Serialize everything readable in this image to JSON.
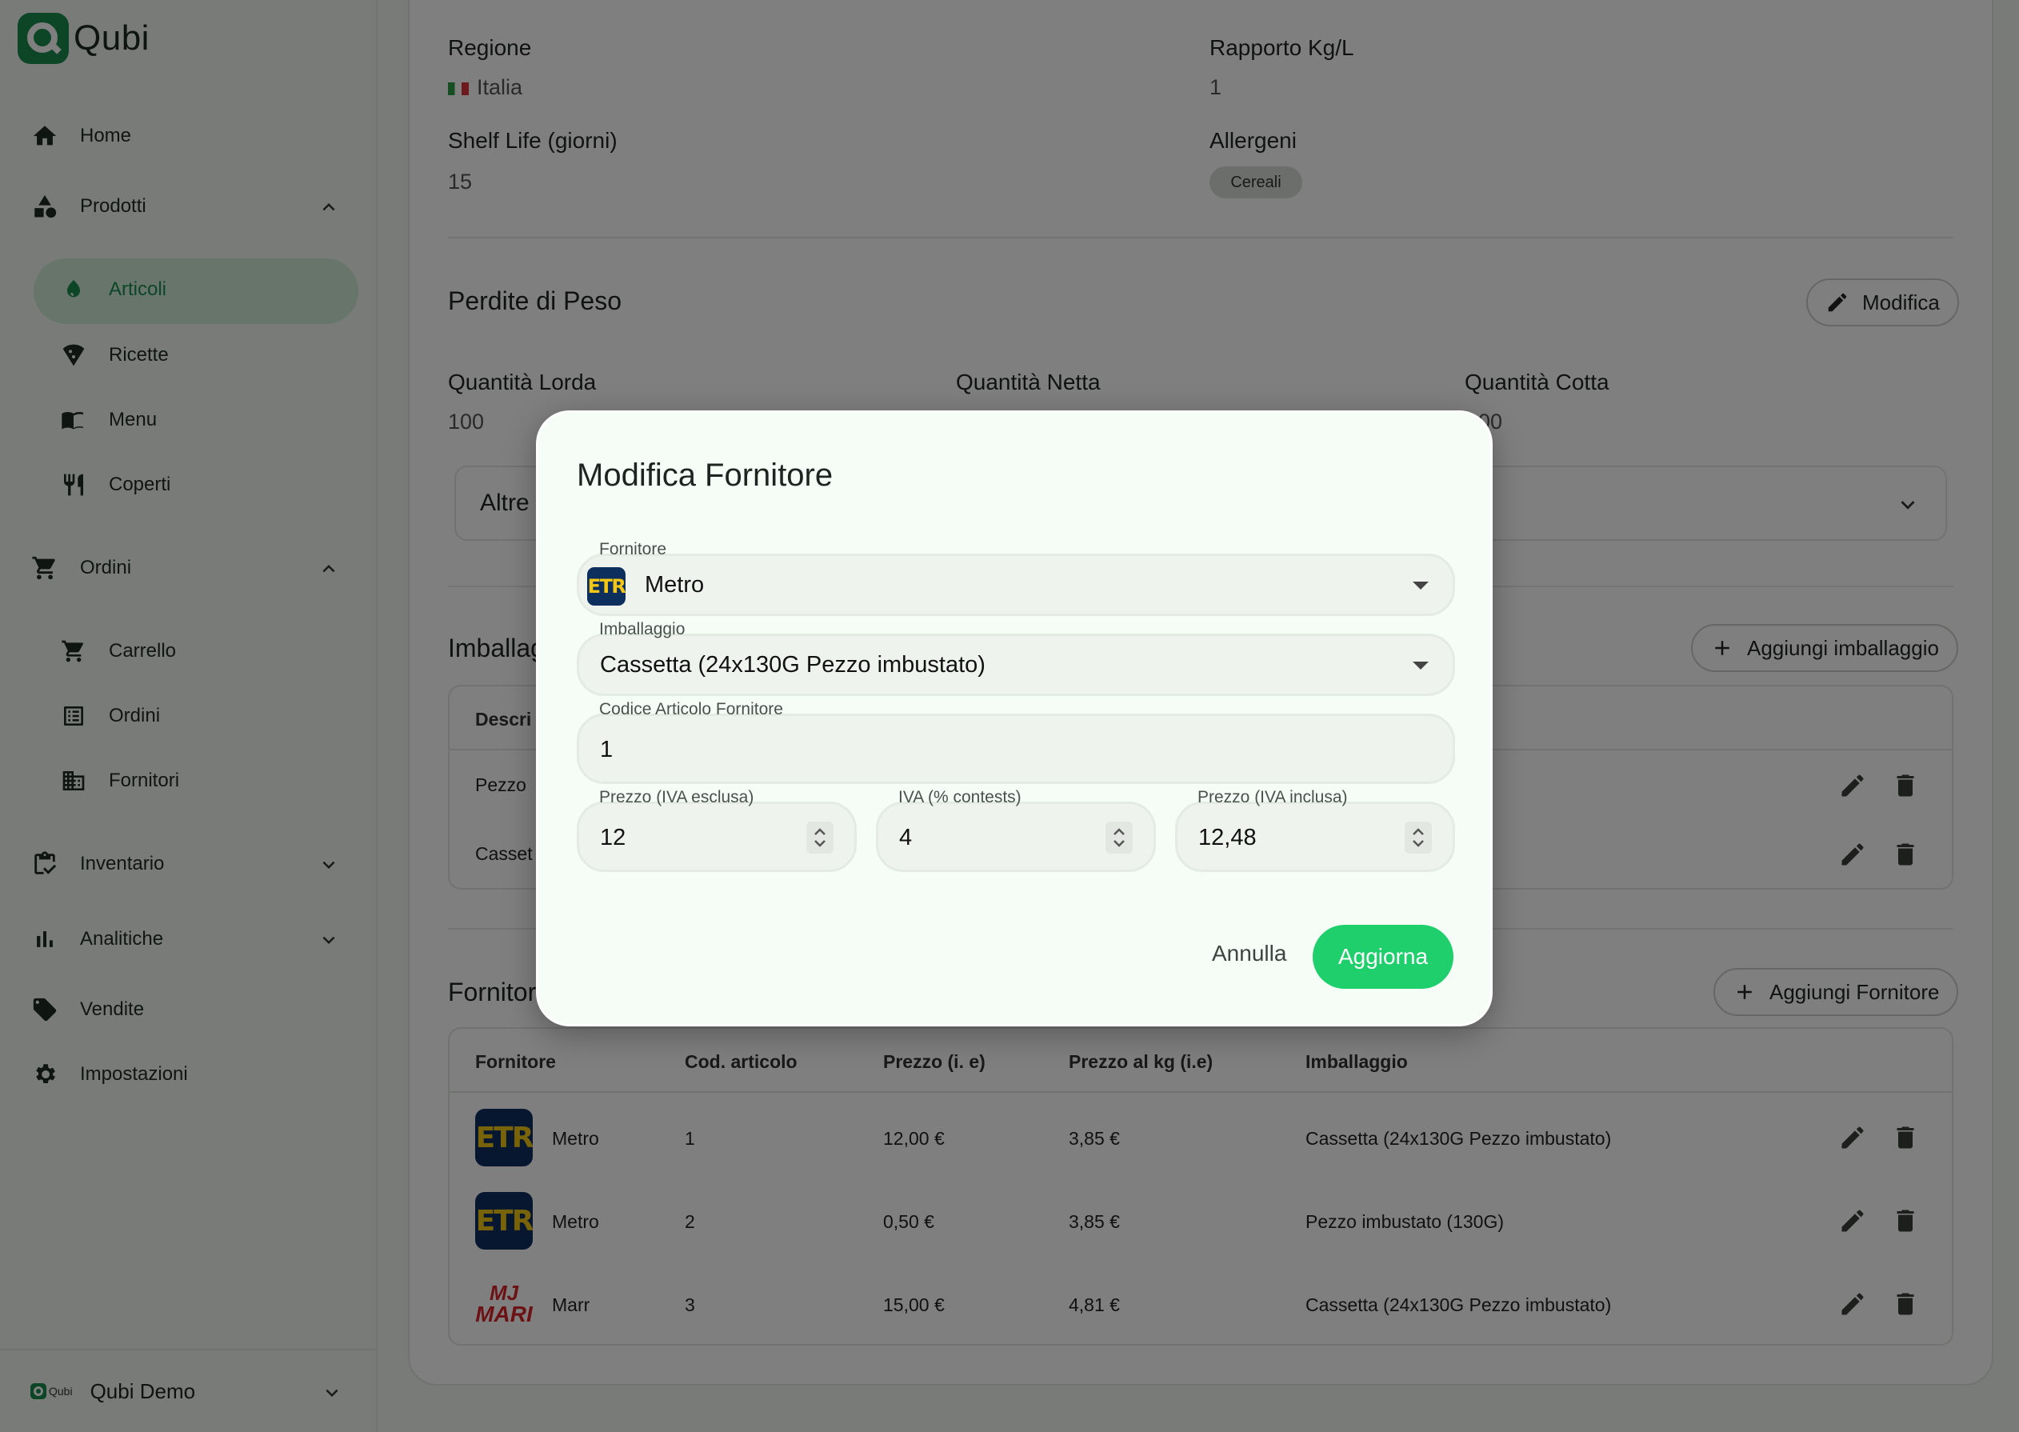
{
  "app": {
    "name": "Qubi"
  },
  "sidebar": {
    "items": [
      {
        "label": "Home",
        "icon": "home-icon"
      },
      {
        "label": "Prodotti",
        "icon": "shapes-icon"
      },
      {
        "label": "Ordini",
        "icon": "cart-icon"
      },
      {
        "label": "Inventario",
        "icon": "clipboard-icon"
      },
      {
        "label": "Analitiche",
        "icon": "bar-chart-icon"
      },
      {
        "label": "Vendite",
        "icon": "tag-icon"
      },
      {
        "label": "Impostazioni",
        "icon": "gear-icon"
      }
    ],
    "prodotti_sub": [
      {
        "label": "Articoli",
        "icon": "leaf-icon"
      },
      {
        "label": "Ricette",
        "icon": "pizza-icon"
      },
      {
        "label": "Menu",
        "icon": "book-icon"
      },
      {
        "label": "Coperti",
        "icon": "cutlery-icon"
      }
    ],
    "ordini_sub": [
      {
        "label": "Carrello",
        "icon": "cart-icon"
      },
      {
        "label": "Ordini",
        "icon": "list-icon"
      },
      {
        "label": "Fornitori",
        "icon": "building-icon"
      }
    ],
    "account": {
      "name": "Qubi Demo",
      "logo_text": "Qubi"
    }
  },
  "details": {
    "regione_label": "Regione",
    "regione_value": "Italia",
    "rapporto_label": "Rapporto Kg/L",
    "rapporto_value": "1",
    "shelf_label": "Shelf Life (giorni)",
    "shelf_value": "15",
    "allergeni_label": "Allergeni",
    "allergeni_chip": "Cereali"
  },
  "perdite": {
    "title": "Perdite di Peso",
    "edit_label": "Modifica",
    "lorda_label": "Quantità Lorda",
    "lorda_value": "100",
    "netta_label": "Quantità Netta",
    "cotta_label": "Quantità Cotta",
    "cotta_value_partial": "00",
    "altre_label": "Altre"
  },
  "imballaggi": {
    "title_partial": "Imballag",
    "add_label": "Aggiungi imballaggio",
    "header_partial": "Descri",
    "rows_partial": [
      "Pezzo",
      "Casset"
    ]
  },
  "fornitori": {
    "title_partial": "Fornitor",
    "add_label": "Aggiungi Fornitore",
    "columns": [
      "Fornitore",
      "Cod. articolo",
      "Prezzo (i. e)",
      "Prezzo al kg (i.e)",
      "Imballaggio"
    ],
    "rows": [
      {
        "fornitore": "Metro",
        "logo_text": "ETR",
        "codice": "1",
        "prezzo": "12,00 €",
        "prezzo_kg": "3,85 €",
        "imballaggio": "Cassetta (24x130G Pezzo imbustato)"
      },
      {
        "fornitore": "Metro",
        "logo_text": "ETR",
        "codice": "2",
        "prezzo": "0,50 €",
        "prezzo_kg": "3,85 €",
        "imballaggio": "Pezzo imbustato (130G)"
      },
      {
        "fornitore": "Marr",
        "logo_top": "MJ",
        "logo_bottom": "MARI",
        "codice": "3",
        "prezzo": "15,00 €",
        "prezzo_kg": "4,81 €",
        "imballaggio": "Cassetta (24x130G Pezzo imbustato)"
      }
    ]
  },
  "modal": {
    "title": "Modifica Fornitore",
    "fornitore_label": "Fornitore",
    "fornitore_value": "Metro",
    "fornitore_logo_text": "ETR",
    "imballaggio_label": "Imballaggio",
    "imballaggio_value": "Cassetta (24x130G Pezzo imbustato)",
    "codice_label": "Codice Articolo Fornitore",
    "codice_value": "1",
    "prezzo_escl_label": "Prezzo (IVA esclusa)",
    "prezzo_escl_value": "12",
    "iva_label": "IVA (% contests)",
    "iva_value": "4",
    "prezzo_incl_label": "Prezzo (IVA inclusa)",
    "prezzo_incl_value": "12,48",
    "cancel_label": "Annulla",
    "confirm_label": "Aggiorna"
  },
  "colors": {
    "accent": "#1b8a4f",
    "primary_button": "#1fcf6b",
    "active_nav_bg": "#cfead6"
  }
}
